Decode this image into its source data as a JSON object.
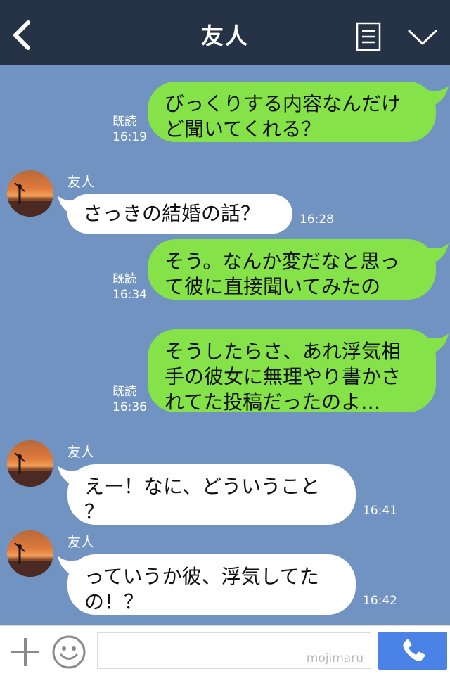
{
  "header": {
    "title": "友人",
    "back_icon": "chevron-left-icon",
    "menu_icon": "note-list-icon",
    "dropdown_icon": "chevron-down-icon"
  },
  "messages": [
    {
      "side": "out",
      "lines": [
        "びっくりする内容なんだけ",
        "ど聞いてくれる？"
      ],
      "read": "既読",
      "time": "16:19"
    },
    {
      "side": "in",
      "sender": "友人",
      "lines": [
        "さっきの結婚の話？"
      ],
      "time": "16:28"
    },
    {
      "side": "out",
      "lines": [
        "そう。なんか変だなと思っ",
        "て彼に直接聞いてみたの"
      ],
      "read": "既読",
      "time": "16:34"
    },
    {
      "side": "out",
      "lines": [
        "そうしたらさ、あれ浮気相",
        "手の彼女に無理やり書かさ",
        "れてた投稿だったのよ…"
      ],
      "read": "既読",
      "time": "16:36"
    },
    {
      "side": "in",
      "sender": "友人",
      "lines": [
        "えー！なに、どういうこと",
        "？"
      ],
      "time": "16:41"
    },
    {
      "side": "in",
      "sender": "友人",
      "lines": [
        "っていうか彼、浮気してた",
        "の！？"
      ],
      "time": "16:42"
    }
  ],
  "footer": {
    "input_value": "",
    "watermark": "mojimaru",
    "plus_icon": "plus-icon",
    "emoji_icon": "smiley-icon",
    "call_icon": "phone-icon"
  },
  "colors": {
    "header_bg": "#263246",
    "chat_bg": "#7193c1",
    "outgoing_bubble": "#85e249",
    "incoming_bubble": "#ffffff",
    "call_button": "#4a82e6"
  }
}
